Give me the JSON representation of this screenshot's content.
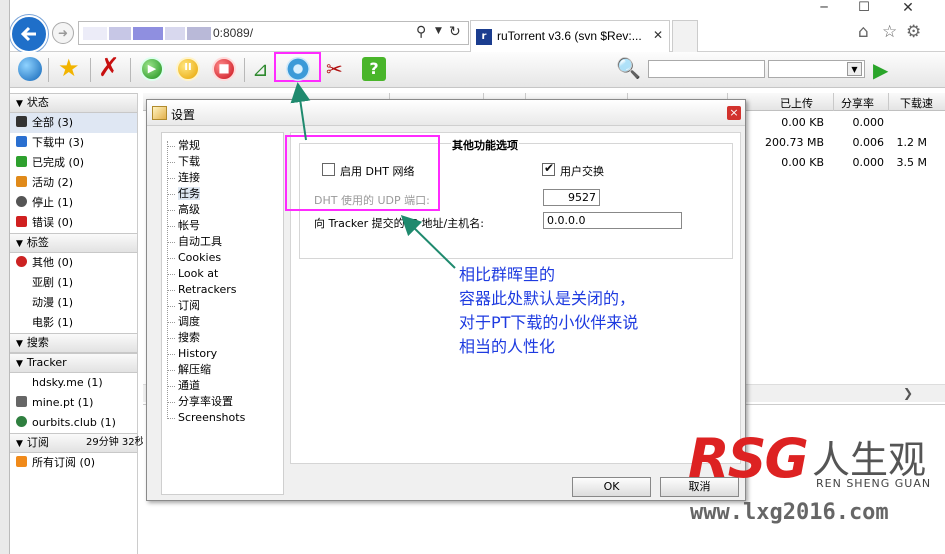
{
  "browser": {
    "address_text": "0:8089/",
    "tab_title": "ruTorrent v3.6 (svn $Rev:...",
    "tab_icon_letter": "r"
  },
  "toolbar": {
    "icons": [
      "globe-icon",
      "star-icon",
      "remove-icon",
      "start-icon",
      "pause-icon",
      "stop-icon",
      "rss-icon",
      "settings-icon",
      "plugins-icon",
      "help-icon"
    ],
    "help_label": "?",
    "search_value": "",
    "search_select_value": ""
  },
  "sidebar": {
    "sections": [
      {
        "title": "状态",
        "items": [
          {
            "label": "全部 (3)",
            "icon": "all-icon",
            "color": "#333333",
            "selected": true
          },
          {
            "label": "下载中 (3)",
            "icon": "downloading-icon",
            "color": "#2a6fd0"
          },
          {
            "label": "已完成 (0)",
            "icon": "completed-icon",
            "color": "#2ea02e"
          },
          {
            "label": "活动 (2)",
            "icon": "active-icon",
            "color": "#e08a1a"
          },
          {
            "label": "停止 (1)",
            "icon": "stopped-icon",
            "color": "#555555"
          },
          {
            "label": "错误 (0)",
            "icon": "error-icon",
            "color": "#d02020"
          }
        ]
      },
      {
        "title": "标签",
        "items": [
          {
            "label": "其他 (0)",
            "icon": "no-label-icon",
            "color": "#cc2222"
          },
          {
            "label": "亚剧 (1)"
          },
          {
            "label": "动漫 (1)"
          },
          {
            "label": "电影 (1)"
          }
        ]
      },
      {
        "title": "搜索",
        "items": []
      },
      {
        "title": "Tracker",
        "items": [
          {
            "label": "hdsky.me (1)"
          },
          {
            "label": "mine.pt (1)",
            "icon": "tracker-mine-icon",
            "color": "#666666"
          },
          {
            "label": "ourbits.club (1)",
            "icon": "tracker-ourbits-icon",
            "color": "#2f7f3f"
          }
        ]
      },
      {
        "title": "订阅",
        "aside": "29分钟 32秒",
        "items": [
          {
            "label": "所有订阅 (0)",
            "icon": "rss-feed-icon",
            "color": "#f08a1a"
          }
        ]
      }
    ]
  },
  "list": {
    "columns": {
      "uploaded": "已上传",
      "ratio": "分享率",
      "dl_speed": "下载速"
    },
    "rows": [
      {
        "uploaded": "0.00 KB",
        "ratio": "0.000",
        "dl_speed": ""
      },
      {
        "uploaded": "200.73 MB",
        "ratio": "0.006",
        "dl_speed": "1.2 M"
      },
      {
        "uploaded": "0.00 KB",
        "ratio": "0.000",
        "dl_speed": "3.5 M"
      }
    ]
  },
  "dialog": {
    "title": "设置",
    "close_label": "×",
    "nav": [
      "常规",
      "下载",
      "连接",
      "任务",
      "高级",
      "帐号",
      "自动工具",
      "Cookies",
      "Look at",
      "Retrackers",
      "订阅",
      "调度",
      "搜索",
      "History",
      "解压缩",
      "通道",
      "分享率设置",
      "Screenshots"
    ],
    "nav_selected": 3,
    "section_title": "其他功能选项",
    "dht_label": "启用 DHT 网络",
    "dht_checked": false,
    "pex_label": "用户交换",
    "pex_checked": true,
    "dht_port_label": "DHT 使用的 UDP 端口:",
    "dht_port_value": "9527",
    "ip_label": "向 Tracker 提交的 IP 地址/主机名:",
    "ip_value": "0.0.0.0",
    "ok_label": "OK",
    "cancel_label": "取消"
  },
  "annotation": {
    "lines": [
      "相比群晖里的",
      "容器此处默认是关闭的，",
      "对于PT下载的小伙伴来说",
      "相当的人性化"
    ],
    "color": "#1e3be0",
    "highlight_color": "#ff2bff",
    "arrow_color": "#1f8a6e"
  },
  "watermark": {
    "brand": "RSG",
    "cn": "人生观",
    "pinyin": "REN SHENG GUAN",
    "url": "www.lxg2016.com"
  }
}
